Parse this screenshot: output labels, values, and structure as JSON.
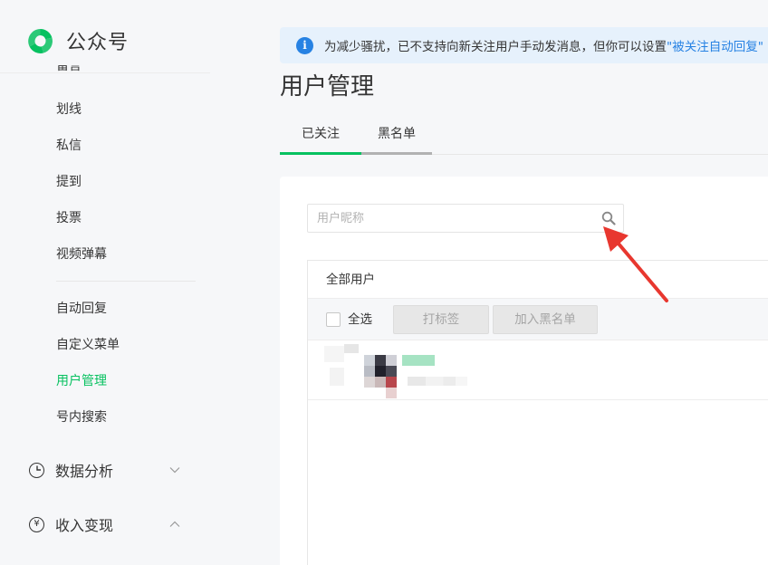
{
  "brand": {
    "name": "公众号",
    "logo_icon": "wechat-official-logo-icon",
    "color": "#07c160"
  },
  "sidebar": {
    "partial_item": "留言",
    "items": [
      {
        "label": "划线",
        "active": false
      },
      {
        "label": "私信",
        "active": false
      },
      {
        "label": "提到",
        "active": false
      },
      {
        "label": "投票",
        "active": false
      },
      {
        "label": "视频弹幕",
        "active": false
      },
      {
        "label": "自动回复",
        "active": false
      },
      {
        "label": "自定义菜单",
        "active": false
      },
      {
        "label": "用户管理",
        "active": true
      },
      {
        "label": "号内搜索",
        "active": false
      }
    ],
    "groups": [
      {
        "label": "数据分析",
        "icon": "clock-chart-icon",
        "chevron": "chevron-down-icon"
      },
      {
        "label": "收入变现",
        "icon": "yen-icon",
        "chevron": "chevron-up-icon"
      }
    ]
  },
  "notice": {
    "text": "为减少骚扰，已不支持向新关注用户手动发消息，但你可以设置",
    "link": "\"被关注自动回复\"",
    "icon": "info-icon"
  },
  "page": {
    "title": "用户管理",
    "tabs": [
      {
        "label": "已关注",
        "active": true
      },
      {
        "label": "黑名单",
        "active": false
      }
    ]
  },
  "search": {
    "placeholder": "用户昵称",
    "value": ""
  },
  "user_panel": {
    "header": "全部用户",
    "select_all": "全选",
    "buttons": {
      "tag": "打标签",
      "blacklist": "加入黑名单"
    }
  },
  "colors": {
    "accent": "#07c160",
    "link": "#2782e3",
    "annotation": "#e8372f"
  }
}
